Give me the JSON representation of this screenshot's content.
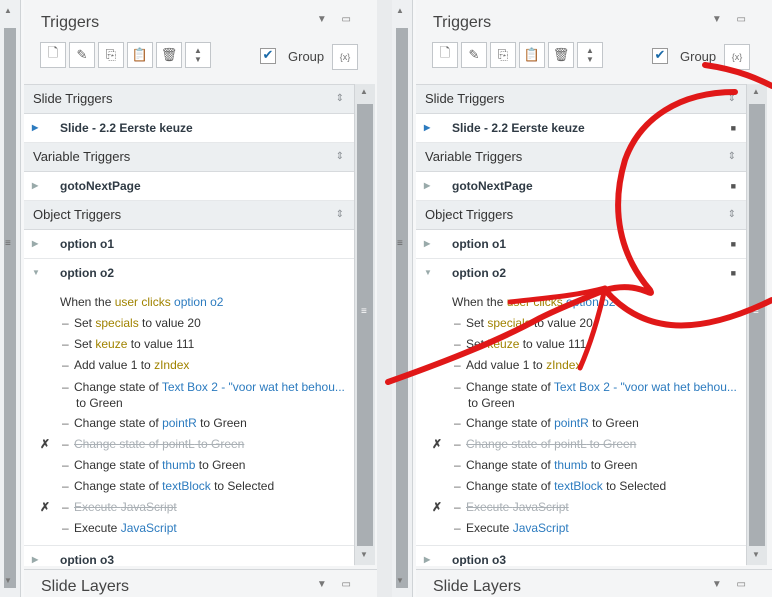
{
  "panel": {
    "title": "Triggers",
    "layers_title": "Slide Layers",
    "group_label": "Group",
    "group_checked": "✔",
    "var_icon": "{x}"
  },
  "sections": {
    "slide": "Slide Triggers",
    "variable": "Variable Triggers",
    "object": "Object Triggers"
  },
  "items": {
    "slide": "Slide - 2.2 Eerste keuze",
    "variable": "gotoNextPage",
    "o1": "option o1",
    "o2": "option o2",
    "o3": "option o3"
  },
  "when": {
    "a": "When the ",
    "b": "user clicks",
    "c": " option o2"
  },
  "actions": [
    {
      "parts": [
        "Set ",
        "specials",
        " to value 20"
      ]
    },
    {
      "parts": [
        "Set ",
        "keuze",
        " to value 111"
      ]
    },
    {
      "parts": [
        "Add value 1 to ",
        "zIndex",
        ""
      ]
    },
    {
      "parts": [
        "Change state of ",
        "Text Box 2 - \"voor wat het behou...",
        "",
        "to Green"
      ]
    },
    {
      "parts": [
        "Change state of ",
        "pointR",
        " to Green"
      ]
    },
    {
      "parts": [
        "Change state of ",
        "pointL",
        " to Green"
      ]
    },
    {
      "parts": [
        "Change state of ",
        "thumb",
        " to Green"
      ]
    },
    {
      "parts": [
        "Change state of ",
        "textBlock",
        " to Selected"
      ]
    },
    {
      "parts": [
        "Execute ",
        "JavaScript",
        ""
      ]
    },
    {
      "parts": [
        "Execute ",
        "JavaScript",
        ""
      ]
    }
  ],
  "icons": {
    "up": "▲",
    "down": "▼",
    "grip": "≡",
    "collapsed": "▶",
    "expanded": "▼",
    "lock": "🔒",
    "disabled": "✗",
    "sort": "⇕"
  },
  "colors": {
    "accent": "#2c7bbf",
    "variable": "#a08300",
    "annotation": "#e01818"
  }
}
